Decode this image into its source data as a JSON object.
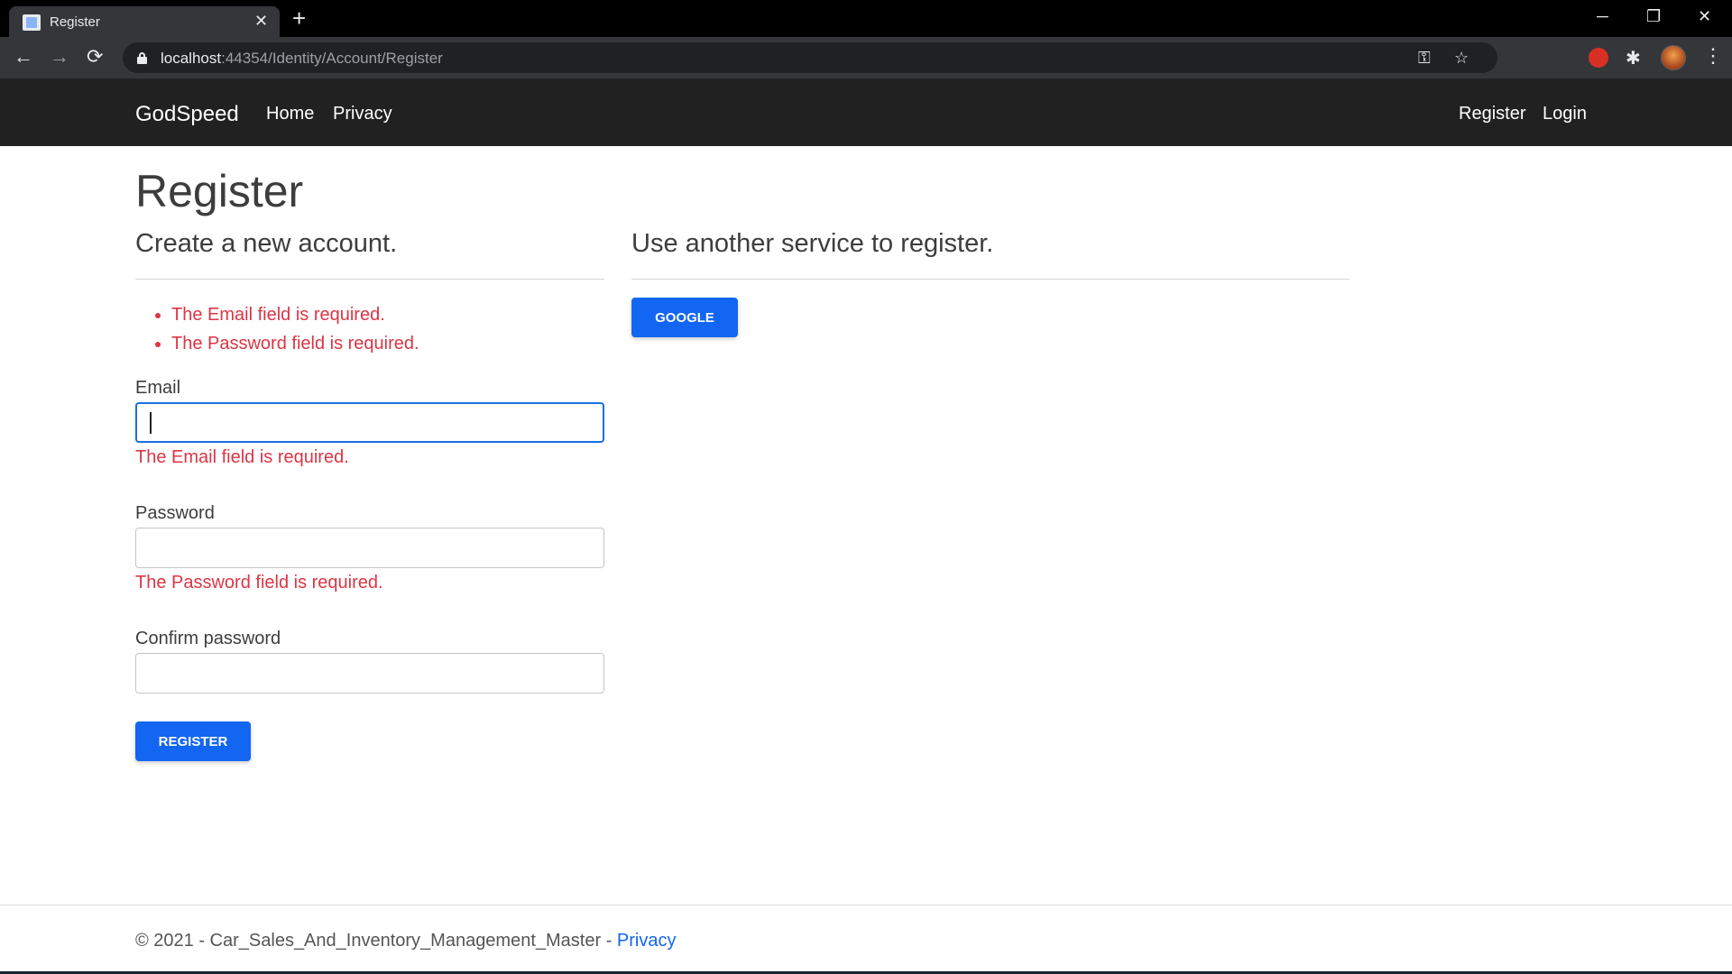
{
  "browser": {
    "tab_title": "Register",
    "tab_close": "✕",
    "new_tab": "+",
    "url_host": "localhost",
    "url_rest": ":44354/Identity/Account/Register",
    "window_controls": {
      "minimize": "─",
      "restore": "❐",
      "close": "✕"
    },
    "nav": {
      "back": "←",
      "forward": "→",
      "reload": "⟳"
    },
    "omnibox_icons": {
      "key": "⚿",
      "star": "☆"
    },
    "menu": "⋮",
    "puzzle": "✱"
  },
  "site_nav": {
    "brand": "GodSpeed",
    "links": [
      "Home",
      "Privacy"
    ],
    "right_links": [
      "Register",
      "Login"
    ]
  },
  "main": {
    "title": "Register",
    "create_heading": "Create a new account.",
    "external_heading": "Use another service to register.",
    "validation_summary": [
      "The Email field is required.",
      "The Password field is required."
    ],
    "email": {
      "label": "Email",
      "value": "",
      "error": "The Email field is required."
    },
    "password": {
      "label": "Password",
      "value": "",
      "error": "The Password field is required."
    },
    "confirm_password": {
      "label": "Confirm password",
      "value": ""
    },
    "register_button": "Register",
    "google_button": "Google"
  },
  "footer": {
    "text": "© 2021 - Car_Sales_And_Inventory_Management_Master - ",
    "link": "Privacy"
  },
  "colors": {
    "accent": "#1266f1",
    "error": "#dc3545",
    "navbar": "#212121"
  }
}
